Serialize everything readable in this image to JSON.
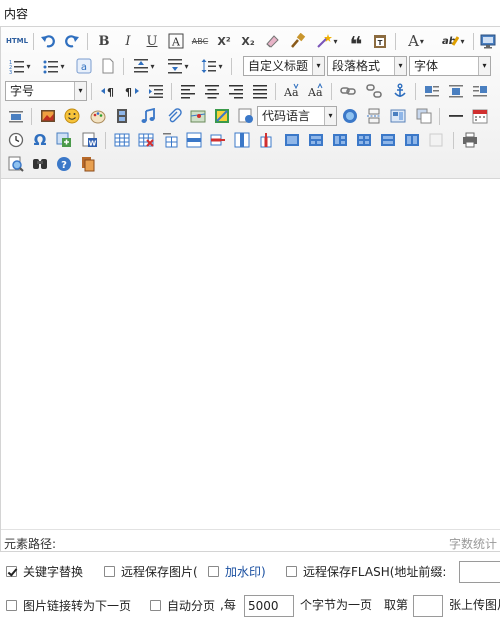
{
  "title": "内容",
  "toolbar": {
    "html_label": "HTML",
    "custom_heading": "自定义标题",
    "paragraph_format": "段落格式",
    "font_family": "字体",
    "font_size": "字号",
    "code_language": "代码语言",
    "dropdown_arrow": "▾",
    "font_color_icon_label": "A",
    "bold": "B",
    "italic": "I",
    "underline": "U",
    "strike": "ABC",
    "superscript": "X²",
    "subscript": "X₂",
    "quote": "❝",
    "omega": "Ω"
  },
  "footer": {
    "path_label": "元素路径:",
    "word_count": "字数统计"
  },
  "options": {
    "keyword_replace": "关键字替换",
    "keyword_replace_checked": true,
    "remote_save_image": "远程保存图片(",
    "watermark_link": "加水印)",
    "remote_save_flash": "远程保存FLASH(地址前缀:",
    "image_link_next": "图片链接转为下一页",
    "auto_paging": "自动分页",
    "every": ",每",
    "paging_chars": "5000",
    "chars_per_page": "个字节为一页",
    "take_nth": "取第",
    "take_nth_value": "",
    "upload_as_thumb": "张上传图片为缩略图"
  },
  "colors": {
    "accent_blue": "#2f6fbf",
    "toolbar_bg": "#f3f3f3",
    "border": "#d4d4d4"
  }
}
